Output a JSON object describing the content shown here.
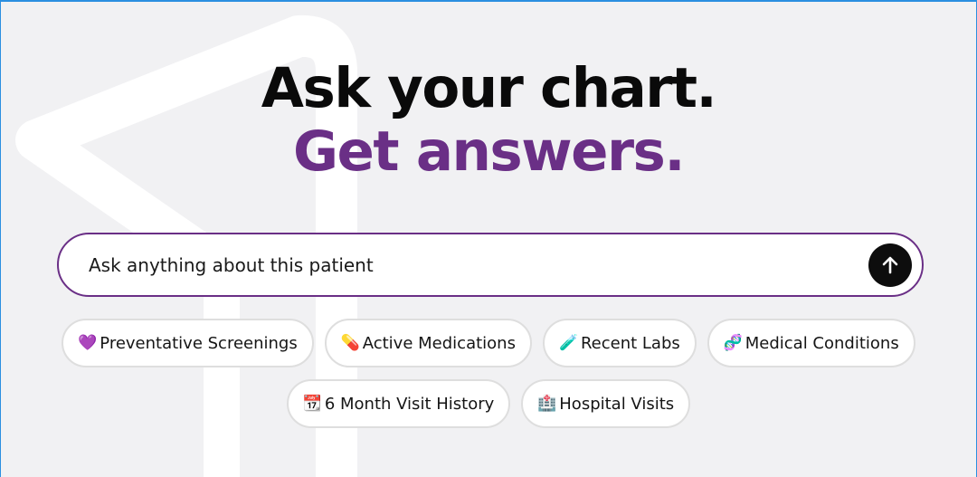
{
  "hero": {
    "line1": "Ask your chart.",
    "line2": "Get answers."
  },
  "search": {
    "placeholder": "Ask anything about this patient",
    "submit_icon": "arrow-up-icon"
  },
  "suggestions": {
    "row1": [
      {
        "emoji": "💜",
        "icon": "purple-heart-icon",
        "label": "Preventative Screenings"
      },
      {
        "emoji": "💊",
        "icon": "pill-icon",
        "label": "Active Medications"
      },
      {
        "emoji": "🧪",
        "icon": "test-tube-icon",
        "label": "Recent Labs"
      },
      {
        "emoji": "🧬",
        "icon": "dna-icon",
        "label": "Medical Conditions"
      }
    ],
    "row2": [
      {
        "emoji": "📆",
        "icon": "calendar-icon",
        "label": "6 Month Visit History"
      },
      {
        "emoji": "🏥",
        "icon": "hospital-icon",
        "label": "Hospital Visits"
      }
    ]
  },
  "colors": {
    "accent": "#6a2f86",
    "background": "#f1f1f3",
    "heading": "#0a0a0a",
    "button": "#0d0d0d"
  }
}
